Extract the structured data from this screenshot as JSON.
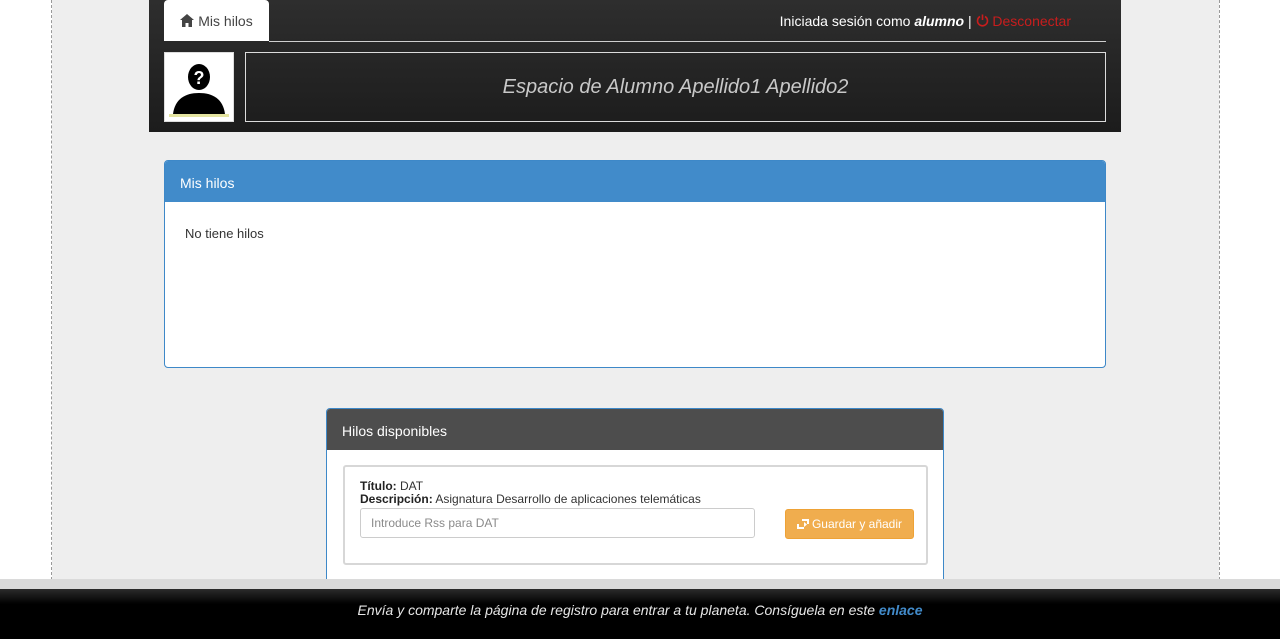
{
  "header": {
    "home_tab_label": "Mis hilos",
    "session_prefix": "Iniciada sesión como",
    "session_user": "alumno",
    "separator": "|",
    "logout_label": "Desconectar",
    "banner_title": "Espacio de Alumno Apellido1 Apellido2"
  },
  "my_threads": {
    "title": "Mis hilos",
    "empty_text": "No tiene hilos"
  },
  "available_threads": {
    "title": "Hilos disponibles",
    "items": [
      {
        "title_label": "Título:",
        "title_value": "DAT",
        "desc_label": "Descripción:",
        "desc_value": "Asignatura Desarrollo de aplicaciones telemáticas",
        "rss_placeholder": "Introduce Rss para DAT",
        "save_label": "Guardar y añadir"
      }
    ]
  },
  "footer": {
    "text": "Envía y comparte la página de registro para entrar a tu planeta. Consíguela en este",
    "link_label": "enlace"
  },
  "colors": {
    "primary": "#418bca",
    "warning": "#f0ad4e",
    "logout": "#c81d1d",
    "dark_panel": "#4d4d4d"
  }
}
